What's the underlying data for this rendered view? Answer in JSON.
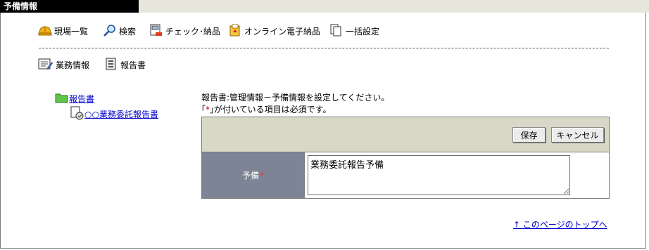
{
  "window": {
    "title": "予備情報"
  },
  "toolbar": {
    "items": [
      {
        "label": "現場一覧",
        "icon": "hardhat-icon"
      },
      {
        "label": "検索",
        "icon": "magnifier-icon"
      },
      {
        "label": "チェック･納品",
        "icon": "checklist-icon"
      },
      {
        "label": "オンライン電子納品",
        "icon": "online-delivery-icon"
      },
      {
        "label": "一括設定",
        "icon": "documents-icon"
      }
    ]
  },
  "subtoolbar": {
    "items": [
      {
        "label": "業務情報",
        "icon": "form-edit-icon"
      },
      {
        "label": "報告書",
        "icon": "report-icon"
      }
    ]
  },
  "tree": {
    "root": {
      "label": "報告書",
      "icon": "folder-icon"
    },
    "child": {
      "label": "○○業務委託報告書",
      "icon": "report-doc-icon"
    }
  },
  "instruction": {
    "line1": "報告書:管理情報－予備情報を設定してください。",
    "line2_prefix": "｢",
    "line2_mark": "*",
    "line2_suffix": "｣が付いている項目は必須です。"
  },
  "form": {
    "save_label": "保存",
    "cancel_label": "キャンセル",
    "field_label": "予備",
    "required_mark": "*",
    "field_value": "業務委託報告予備"
  },
  "footer": {
    "top_link": "↑ このページのトップへ"
  },
  "colors": {
    "title_bg": "#000000",
    "panel_header": "#d8d8c8",
    "label_cell": "#7d8495",
    "link": "#0000cc",
    "required": "#cc0000"
  }
}
